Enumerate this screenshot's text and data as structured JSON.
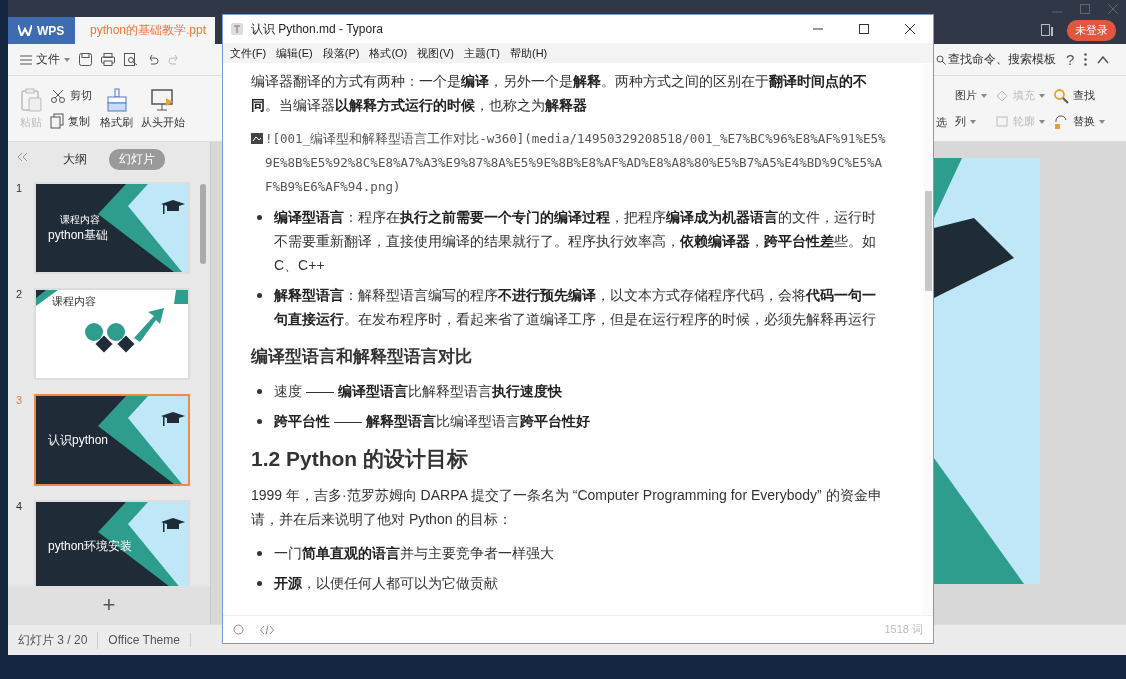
{
  "wps": {
    "tabs": [
      {
        "label": "WPS",
        "kind": "home",
        "selected": false
      },
      {
        "label": "python的基础教学.ppt",
        "kind": "doc",
        "selected": true
      }
    ],
    "login_button": "未登录",
    "file_menu": "文件",
    "search_placeholder": "查找命令、搜索模板",
    "help": "?",
    "ribbon_left": [
      {
        "label": "粘贴",
        "kind": "paste",
        "disabled": true
      },
      {
        "label": "剪切",
        "kind": "cut",
        "disabled": false
      },
      {
        "label": "复制",
        "kind": "copy",
        "disabled": false
      },
      {
        "label": "格式刷",
        "kind": "brush",
        "disabled": false
      },
      {
        "label": "从头开始",
        "kind": "play",
        "disabled": false
      }
    ],
    "ribbon_right": [
      {
        "label": "图片",
        "kind": "plain",
        "disabled": false
      },
      {
        "label": "填充",
        "kind": "fill",
        "disabled": true
      },
      {
        "label": "查找",
        "kind": "find",
        "disabled": false
      },
      {
        "label": "列",
        "kind": "plain",
        "disabled": false
      },
      {
        "label": "轮廓",
        "kind": "outline",
        "disabled": true
      },
      {
        "label": "替换",
        "kind": "replace",
        "disabled": false
      }
    ],
    "ribbon_cut": "选",
    "panel_tabs": [
      {
        "label": "大纲",
        "selected": false
      },
      {
        "label": "幻灯片",
        "selected": true
      }
    ],
    "slides": [
      {
        "number": "1",
        "kind": "dark",
        "selected": false,
        "subtitle": "课程内容",
        "title": "python基础"
      },
      {
        "number": "2",
        "kind": "light",
        "selected": false,
        "title": "课程内容"
      },
      {
        "number": "3",
        "kind": "dark",
        "selected": true,
        "title": "认识python"
      },
      {
        "number": "4",
        "kind": "dark",
        "selected": false,
        "title": "python环境安装"
      }
    ],
    "add_slide": "+",
    "status": [
      "幻灯片 3 / 20",
      "Office Theme"
    ]
  },
  "typora": {
    "title": "认识 Python.md - Typora",
    "menu": [
      "文件(F)",
      "编辑(E)",
      "段落(P)",
      "格式(O)",
      "视图(V)",
      "主题(T)",
      "帮助(H)"
    ],
    "blocks": [
      {
        "kind": "p",
        "text": "编译器翻译的方式有两种：一个是**编译**，另外一个是**解释**。两种方式之间的区别在于**翻译时间点的不同**。当编译器**以解释方式运行的时候**，也称之为**解释器**"
      },
      {
        "kind": "image",
        "text": "![001_编译型和解释型语言工作对比-w360](media/14950329208518/001_%E7%BC%96%E8%AF%91%E5%9E%8B%E5%92%8C%E8%A7%A3%E9%87%8A%E5%9E%8B%E8%AF%AD%E8%A8%80%E5%B7%A5%E4%BD%9C%E5%AF%B9%E6%AF%94.png)"
      },
      {
        "kind": "li",
        "text": "**编译型语言**：程序在**执行之前需要一个专门的编译过程**，把程序**编译成为机器语言**的文件，运行时不需要重新翻译，直接使用编译的结果就行了。程序执行效率高，**依赖编译器**，**跨平台性差**些。如 C、C++"
      },
      {
        "kind": "li",
        "text": "**解释型语言**：解释型语言编写的程序**不进行预先编译**，以文本方式存储程序代码，会将**代码一句一句直接运行**。在发布程序时，看起来省了道编译工序，但是在运行程序的时候，必须先解释再运行"
      },
      {
        "kind": "h3",
        "text": "编译型语言和解释型语言对比"
      },
      {
        "kind": "li",
        "text": "速度 —— **编译型语言**比解释型语言**执行速度快**"
      },
      {
        "kind": "li",
        "text": "**跨平台性** —— **解释型语言**比编译型语言**跨平台性好**"
      },
      {
        "kind": "h2",
        "text": "1.2 Python 的设计目标"
      },
      {
        "kind": "p",
        "text": "1999 年，吉多·范罗苏姆向 DARPA 提交了一条名为 “Computer Programming for Everybody” 的资金申请，并在后来说明了他对 Python 的目标："
      },
      {
        "kind": "li",
        "text": "一门**简单直观的语言**并与主要竞争者一样强大"
      },
      {
        "kind": "li",
        "text": "**开源**，以便任何人都可以为它做贡献"
      }
    ],
    "word_count": "1518 词"
  }
}
